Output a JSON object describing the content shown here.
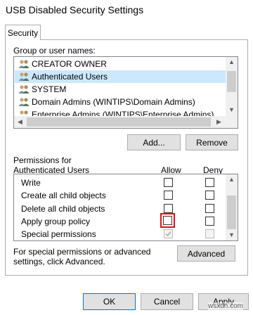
{
  "window": {
    "title": "USB Disabled Security Settings"
  },
  "tabs": [
    {
      "label": "Security"
    }
  ],
  "group_section": {
    "label": "Group or user names:",
    "users": [
      {
        "name": "CREATOR OWNER",
        "icon": "users-group-icon"
      },
      {
        "name": "Authenticated Users",
        "icon": "users-group-icon"
      },
      {
        "name": "SYSTEM",
        "icon": "users-group-icon"
      },
      {
        "name": "Domain Admins (WINTIPS\\Domain Admins)",
        "icon": "users-group-icon"
      },
      {
        "name": "Enterprise Admins (WINTIPS\\Enterprise Admins)",
        "icon": "users-group-icon"
      }
    ],
    "selected_index": 1
  },
  "buttons": {
    "add": "Add...",
    "remove": "Remove",
    "advanced": "Advanced",
    "ok": "OK",
    "cancel": "Cancel",
    "apply": "Apply"
  },
  "permissions": {
    "label": "Permissions for Authenticated Users",
    "allow_header": "Allow",
    "deny_header": "Deny",
    "rows": [
      {
        "name": "Write",
        "allow": false,
        "deny": false
      },
      {
        "name": "Create all child objects",
        "allow": false,
        "deny": false
      },
      {
        "name": "Delete all child objects",
        "allow": false,
        "deny": false
      },
      {
        "name": "Apply group policy",
        "allow": false,
        "deny": false,
        "highlighted": true
      },
      {
        "name": "Special permissions",
        "allow": true,
        "deny": false,
        "disabled": true
      }
    ]
  },
  "advanced_note": "For special permissions or advanced settings, click Advanced.",
  "watermark": "wsxdn.com",
  "colors": {
    "selection": "#cce8ff",
    "highlight_box": "#e0101a",
    "scrollbar_thumb": "#cdcdcd",
    "border": "#adadad"
  }
}
